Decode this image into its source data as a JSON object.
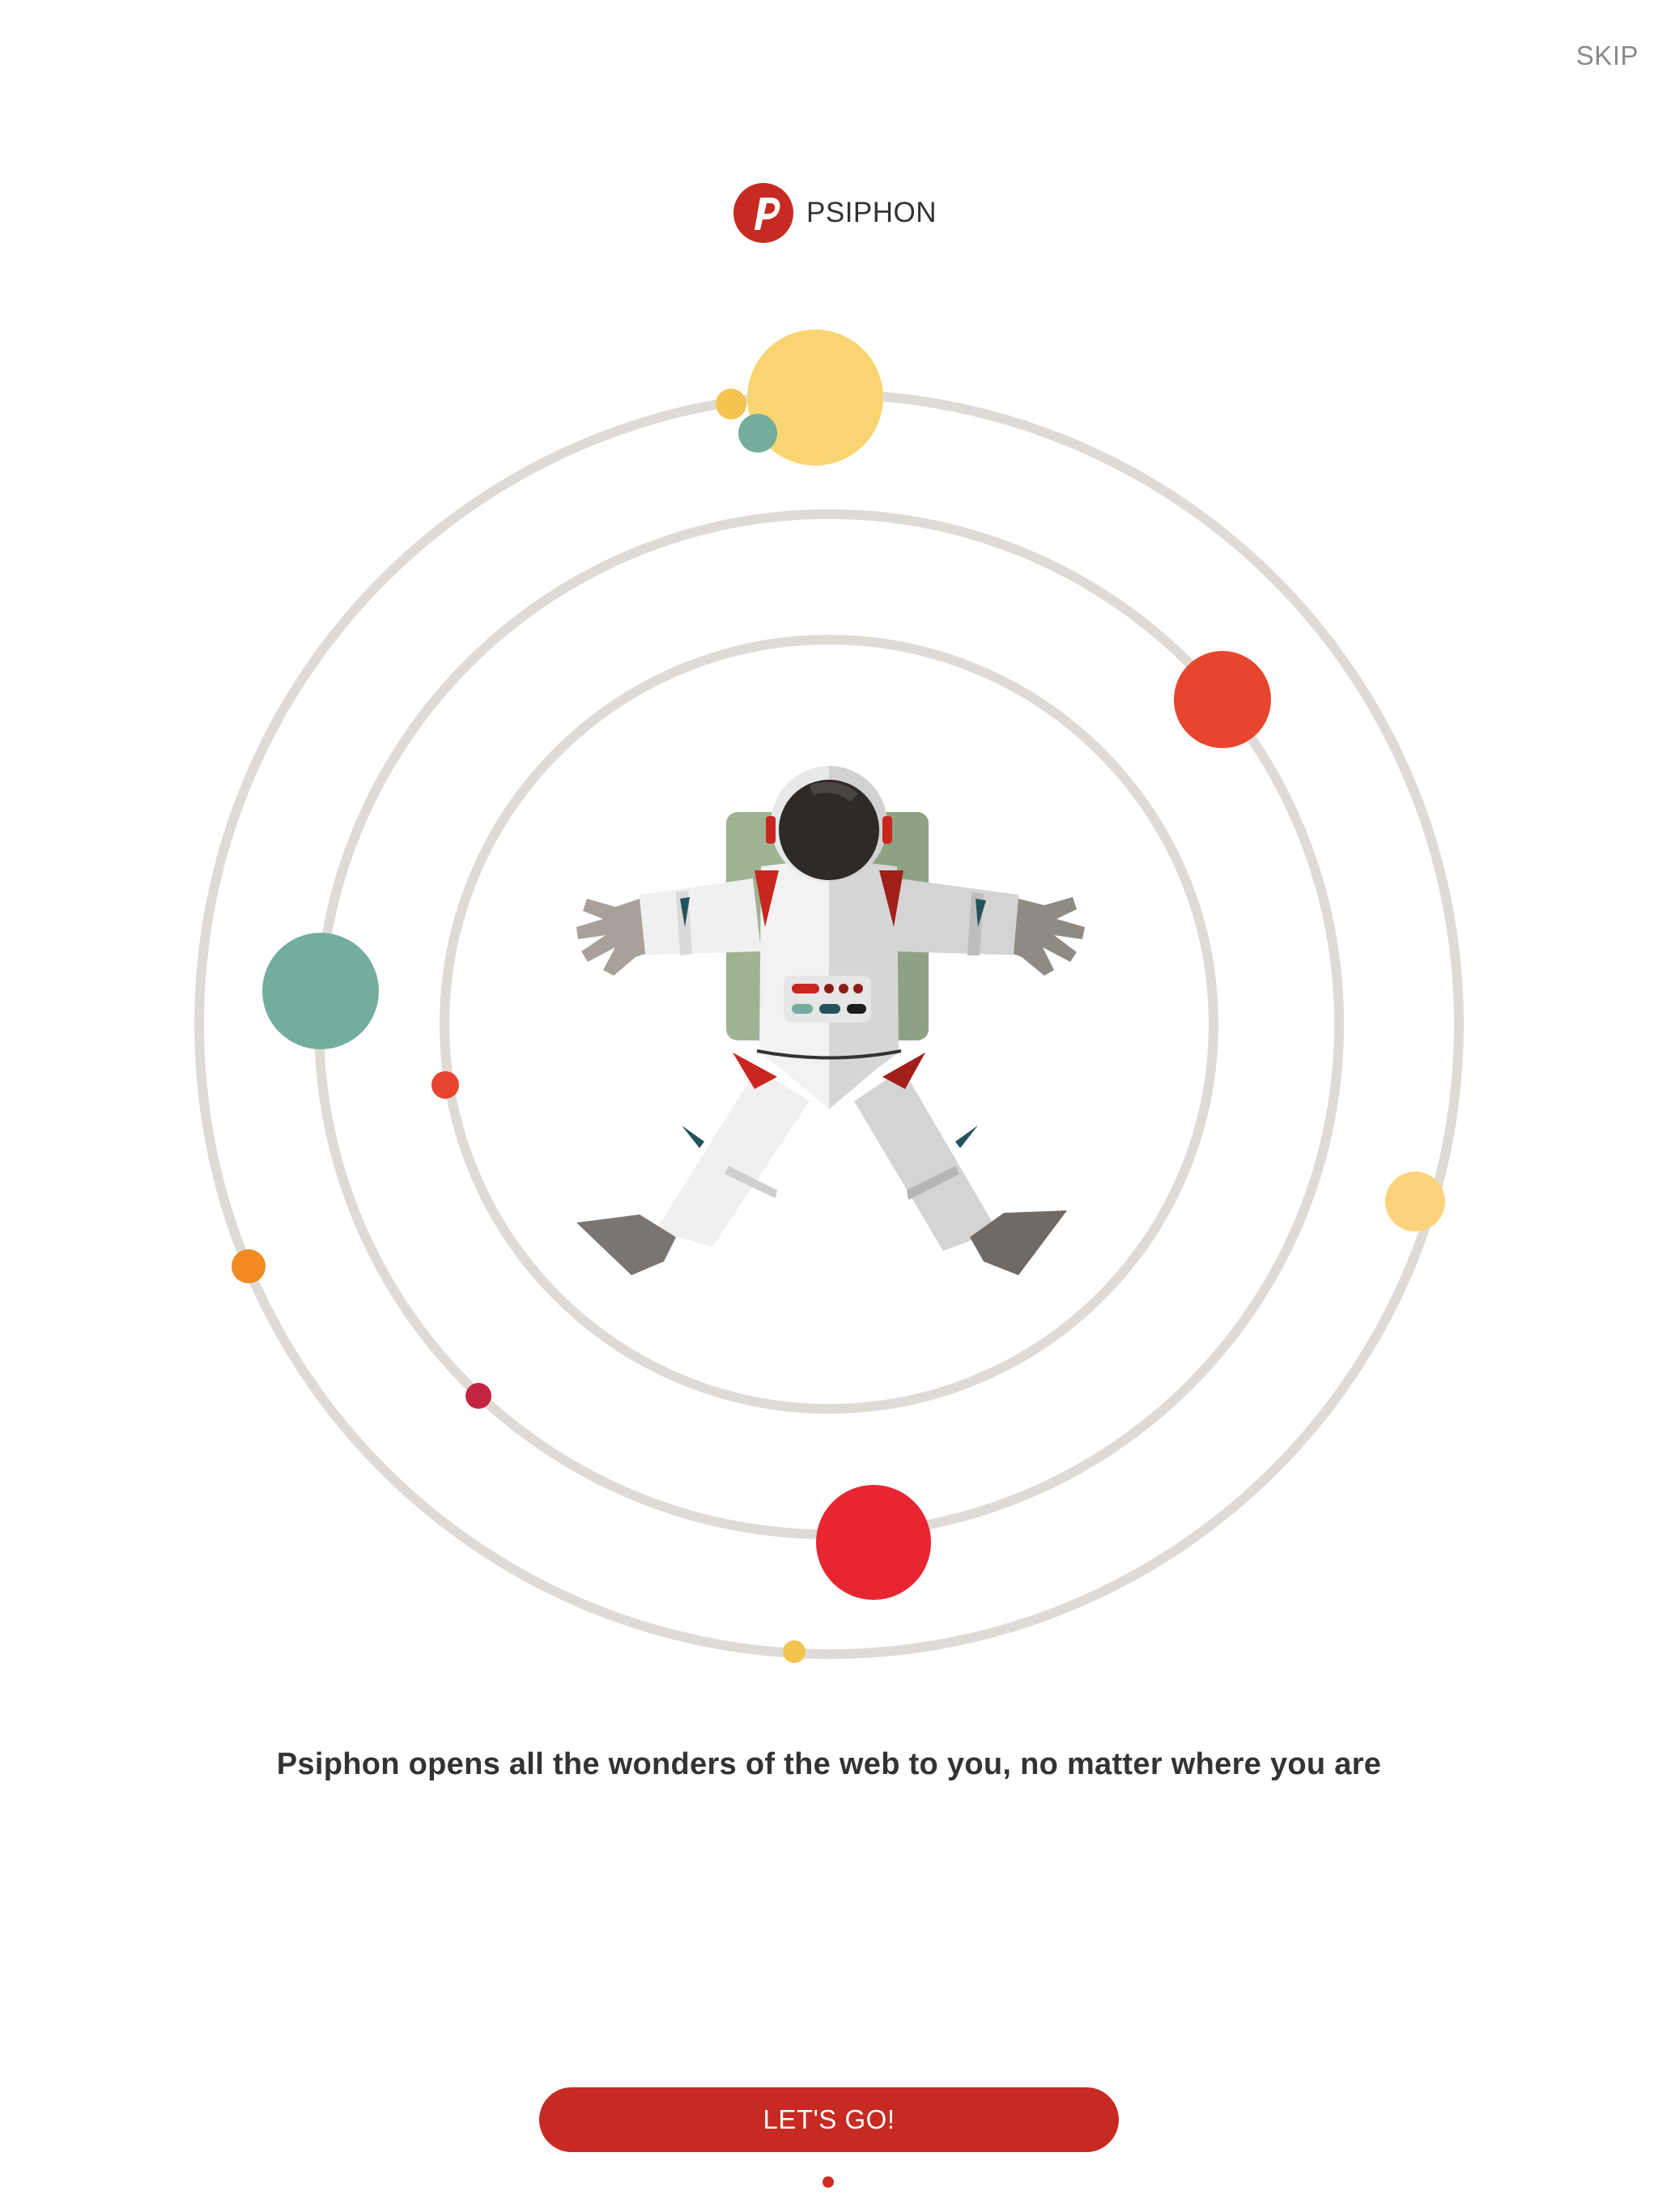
{
  "header": {
    "skip_label": "SKIP"
  },
  "brand": {
    "name": "PSIPHON",
    "logo_icon": "psiphon-p-logo-icon",
    "logo_color": "#c62a22"
  },
  "illustration": {
    "subject": "astronaut-icon",
    "orbit_color": "#dedbd7",
    "planet_colors": [
      "#f8d572",
      "#74ad9d",
      "#e8452f",
      "#e72631",
      "#fdd27c",
      "#f08a21",
      "#c32541"
    ]
  },
  "onboarding": {
    "tagline": "Psiphon opens all the wonders of the web to you, no matter where you are",
    "cta_label": "LET'S GO!",
    "page_indicator": {
      "current": 1,
      "total": 1
    },
    "accent_color": "#c62a22"
  }
}
